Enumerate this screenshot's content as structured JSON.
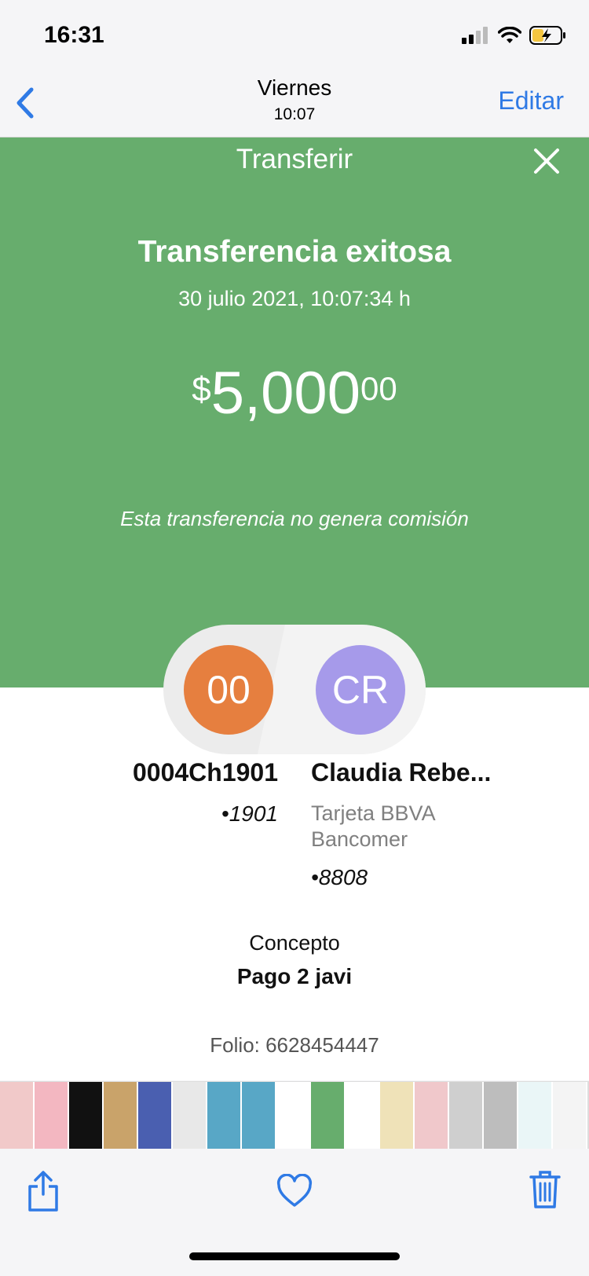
{
  "status_bar": {
    "time": "16:31"
  },
  "nav": {
    "title": "Viernes",
    "subtitle": "10:07",
    "edit_label": "Editar"
  },
  "receipt": {
    "header": "Transferir",
    "headline": "Transferencia exitosa",
    "datetime": "30 julio 2021, 10:07:34 h",
    "amount_currency": "$",
    "amount_integer": "5,000",
    "amount_decimals": "00",
    "fee_note": "Esta transferencia no genera comisión",
    "from": {
      "initials": "00",
      "name": "0004Ch1901",
      "number": "•1901"
    },
    "to": {
      "initials": "CR",
      "name": "Claudia Rebe...",
      "bank_line1": "Tarjeta BBVA",
      "bank_line2": "Bancomer",
      "number": "•8808"
    },
    "concept_label": "Concepto",
    "concept_value": "Pago 2 javi",
    "folio": "Folio: 6628454447",
    "colors": {
      "green": "#67ad6d",
      "from_avatar": "#e67f3f",
      "to_avatar": "#a69aea",
      "ios_blue": "#2f7ae5"
    }
  },
  "filmstrip": {
    "thumb_colors": [
      "#f1c9c9",
      "#f3b7c1",
      "#111111",
      "#c9a36a",
      "#4a5fb0",
      "#e8e8e8",
      "#58a7c6",
      "#58a7c6",
      "#ffffff",
      "#67ad6d",
      "#ffffff",
      "#efe2b8",
      "#f0c8cb",
      "#cfcfcf",
      "#bdbdbd",
      "#eaf6f7",
      "#f4f4f4",
      "#dddddd",
      "#8fb07a",
      "#cccccc"
    ]
  },
  "toolbar": {
    "icons": [
      "share-icon",
      "heart-icon",
      "trash-icon"
    ]
  }
}
